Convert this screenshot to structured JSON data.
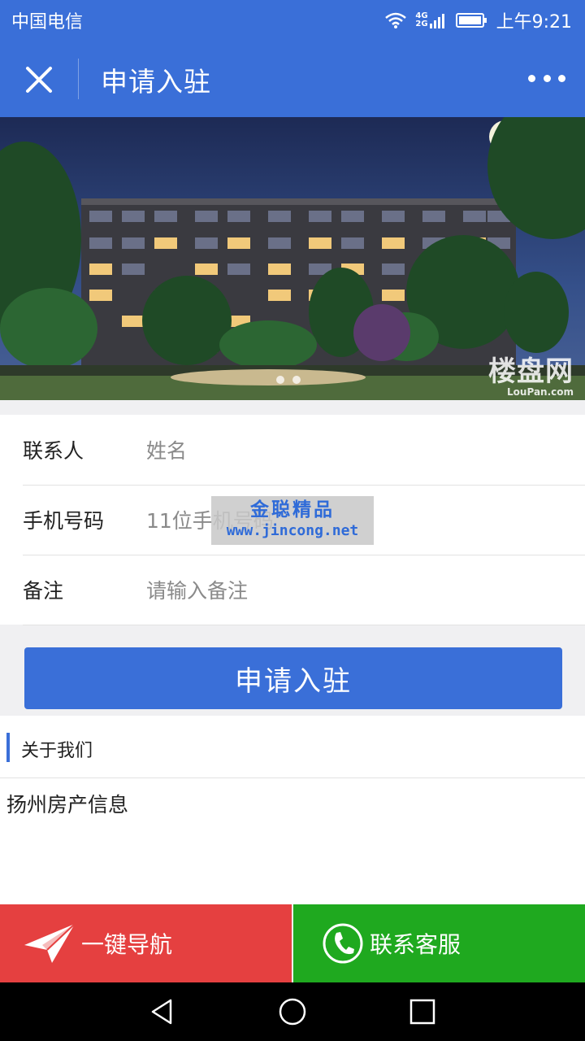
{
  "status_bar": {
    "carrier": "中国电信",
    "signal_text_1": "4G",
    "signal_text_2": "2G",
    "time": "上午9:21"
  },
  "header": {
    "title": "申请入驻",
    "close_icon": "close-icon",
    "more_icon": "more-dots-icon"
  },
  "banner": {
    "watermark_big": "楼盘网",
    "watermark_small": "LouPan.com",
    "page_count": 2,
    "active_index": 0
  },
  "form": {
    "rows": [
      {
        "label": "联系人",
        "placeholder": "姓名"
      },
      {
        "label": "手机号码",
        "placeholder": "11位手机号码"
      },
      {
        "label": "备注",
        "placeholder": "请输入备注"
      }
    ]
  },
  "overlay_watermark": {
    "line1": "金聪精品",
    "line2": "www.jincong.net"
  },
  "submit_label": "申请入驻",
  "about": {
    "title": "关于我们",
    "text": "扬州房产信息"
  },
  "bottom_bar": {
    "navigate_label": "一键导航",
    "contact_label": "联系客服",
    "navigate_color": "#e54040",
    "contact_color": "#1fa91f"
  },
  "colors": {
    "brand": "#3a6fd8"
  }
}
